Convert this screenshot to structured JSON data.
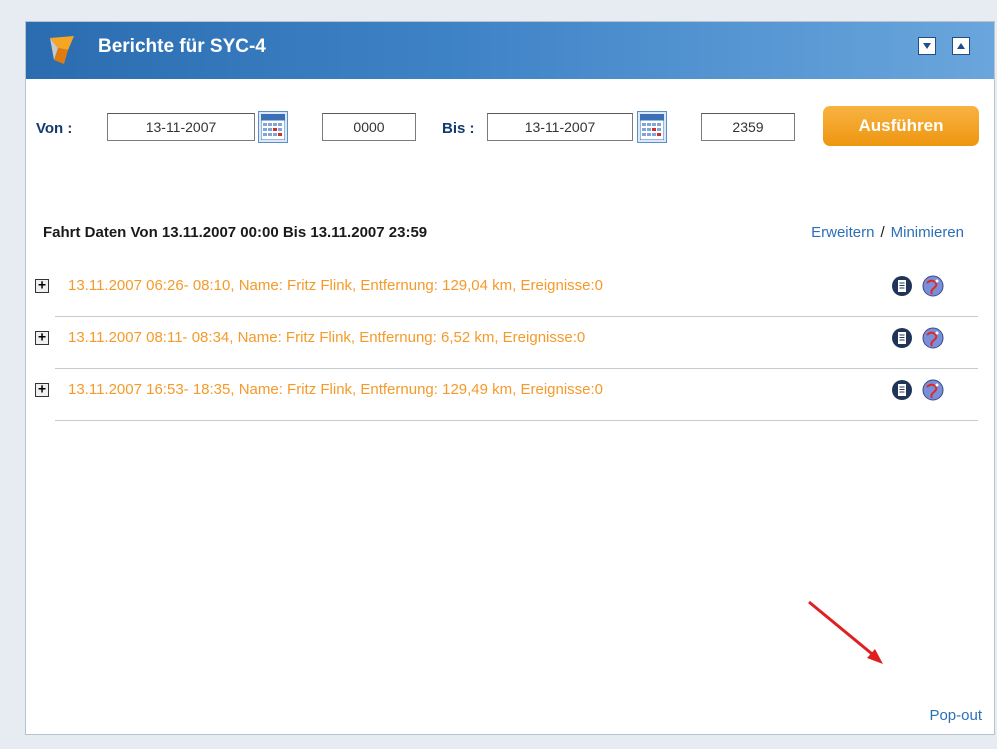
{
  "header": {
    "title": "Berichte für  SYC-4",
    "minimize_icon": "triangle-down-icon",
    "maximize_icon": "triangle-up-icon"
  },
  "filter": {
    "from_label": "Von :",
    "from_date": "13-11-2007",
    "from_time": "0000",
    "to_label": "Bis :",
    "to_date": "13-11-2007",
    "to_time": "2359",
    "run_button": "Ausführen"
  },
  "section": {
    "title": "Fahrt Daten Von 13.11.2007 00:00 Bis 13.11.2007 23:59",
    "expand_link": "Erweitern",
    "separator": "/",
    "collapse_link": "Minimieren"
  },
  "trips": [
    {
      "text": "13.11.2007 06:26- 08:10, Name: Fritz Flink, Entfernung: 129,04 km, Ereignisse:0",
      "expand": "+"
    },
    {
      "text": "13.11.2007 08:11- 08:34, Name: Fritz Flink, Entfernung: 6,52 km, Ereignisse:0",
      "expand": "+"
    },
    {
      "text": "13.11.2007 16:53- 18:35, Name: Fritz Flink, Entfernung: 129,49 km, Ereignisse:0",
      "expand": "+"
    }
  ],
  "footer": {
    "popout_link": "Pop-out"
  },
  "colors": {
    "title_bar": "#3f83c7",
    "trip_text": "#f59a2a",
    "link": "#2c6fb7",
    "run_button": "#f0a020"
  }
}
